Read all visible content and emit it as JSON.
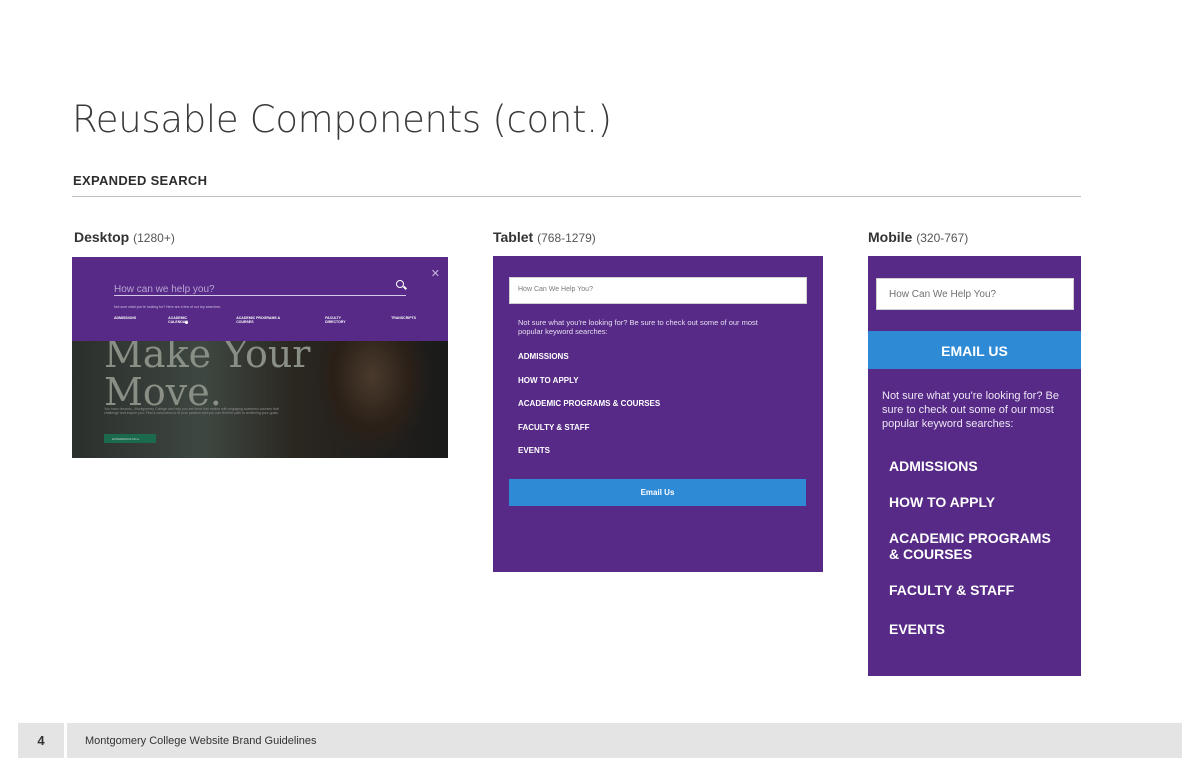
{
  "page": {
    "title": "Reusable Components (cont.)",
    "section": "EXPANDED SEARCH"
  },
  "labels": {
    "desktop": {
      "name": "Desktop",
      "range": "(1280+)"
    },
    "tablet": {
      "name": "Tablet",
      "range": "(768-1279)"
    },
    "mobile": {
      "name": "Mobile",
      "range": "(320-767)"
    }
  },
  "desktop": {
    "placeholder": "How can we help you?",
    "hint": "Not sure what you're looking for? Here are a few of our top searches:",
    "links": [
      "ADMISSIONS",
      "ACADEMIC CALENDAR",
      "ACADEMIC PROGRAMS & COURSES",
      "FACULTY DIRECTORY",
      "TRANSCRIPTS"
    ],
    "hero_line1": "Make Your",
    "hero_line2": "Move.",
    "hero_copy": "You have dreams—Montgomery College can help you set them into motion with engaging academic courses that challenge and inspire you. Find a curriculum to fit your passion and you can find the path to achieving your goals.",
    "cta": "EXPERIENCE MC ▸",
    "close_icon": "close-icon",
    "search_icon": "search-icon"
  },
  "tablet": {
    "placeholder": "How Can We Help You?",
    "hint": "Not sure what you're looking for? Be sure to check out some of our most popular keyword searches:",
    "links": [
      "ADMISSIONS",
      "HOW TO APPLY",
      "ACADEMIC PROGRAMS & COURSES",
      "FACULTY & STAFF",
      "EVENTS"
    ],
    "button": "Email Us"
  },
  "mobile": {
    "placeholder": "How Can We Help You?",
    "button": "EMAIL US",
    "hint": "Not sure what you're looking for? Be sure to check out some of our most popular keyword searches:",
    "links": [
      "ADMISSIONS",
      "HOW TO APPLY",
      "ACADEMIC PROGRAMS & COURSES",
      "FACULTY & STAFF",
      "EVENTS"
    ]
  },
  "footer": {
    "page_number": "4",
    "text": "Montgomery College Website Brand Guidelines"
  },
  "colors": {
    "purple": "#562a86",
    "blue": "#2f8ad6"
  }
}
